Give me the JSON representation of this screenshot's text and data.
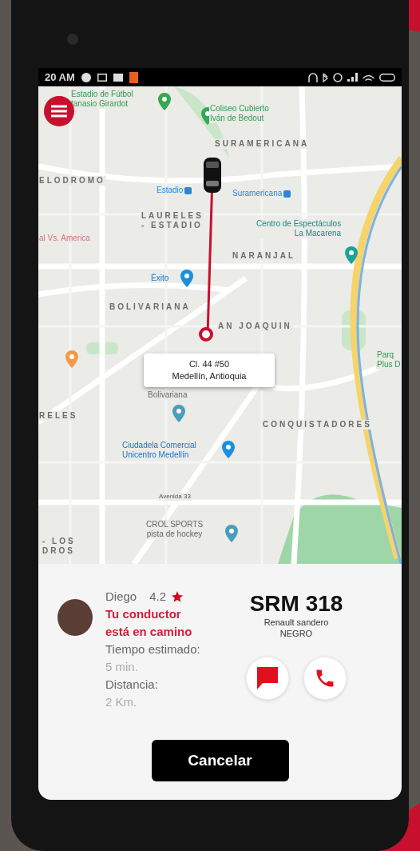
{
  "status_bar": {
    "time": "20 AM"
  },
  "map": {
    "labels": [
      {
        "kind": "poi-green",
        "text": "Estadio de Fútbol\ntanasio Girardot"
      },
      {
        "kind": "poi-green",
        "text": "Coliseo Cubierto\nIván de Bedout"
      },
      {
        "kind": "district",
        "text": "SURAMERICANA"
      },
      {
        "kind": "district",
        "text": "ELODROMO"
      },
      {
        "kind": "transit",
        "text": "Estadio"
      },
      {
        "kind": "transit",
        "text": "Suramericana"
      },
      {
        "kind": "district",
        "text": "LAURELES\n- ESTADIO"
      },
      {
        "kind": "poi-teal",
        "text": "Centro de Espectáculos\nLa Macarena"
      },
      {
        "kind": "poi-pink",
        "text": "al Vs. America"
      },
      {
        "kind": "district",
        "text": "NARANJAL"
      },
      {
        "kind": "poi-blue",
        "text": "Éxito"
      },
      {
        "kind": "district",
        "text": "BOLIVARIANA"
      },
      {
        "kind": "district",
        "text": "AN JOAQUIN"
      },
      {
        "kind": "poi-green",
        "text": "Parq\nPlus D"
      },
      {
        "kind": "district",
        "text": "RELES"
      },
      {
        "kind": "place",
        "text": "Bolivariana"
      },
      {
        "kind": "district",
        "text": "CONQUISTADORES"
      },
      {
        "kind": "poi-blue",
        "text": "Ciudadela Comercial\nUnicentro Medellín"
      },
      {
        "kind": "road",
        "text": "Avenida 33"
      },
      {
        "kind": "place",
        "text": "CROL SPORTS\npista de hockey"
      },
      {
        "kind": "district",
        "text": "- LOS\nDROS"
      }
    ],
    "callout": [
      "Cl. 44 #50",
      "Medellín, Antioquia"
    ]
  },
  "driver": {
    "name": "Diego",
    "rating": "4.2",
    "status": "Tu conductor\nestá en camino",
    "eta_label": "Tiempo estimado:",
    "eta": "5 min.",
    "distance_label": "Distancia:",
    "distance": "2 Km."
  },
  "vehicle": {
    "plate": "SRM 318",
    "model": "Renault sandero",
    "color_name": "NEGRO"
  },
  "cancel_button": "Cancelar"
}
